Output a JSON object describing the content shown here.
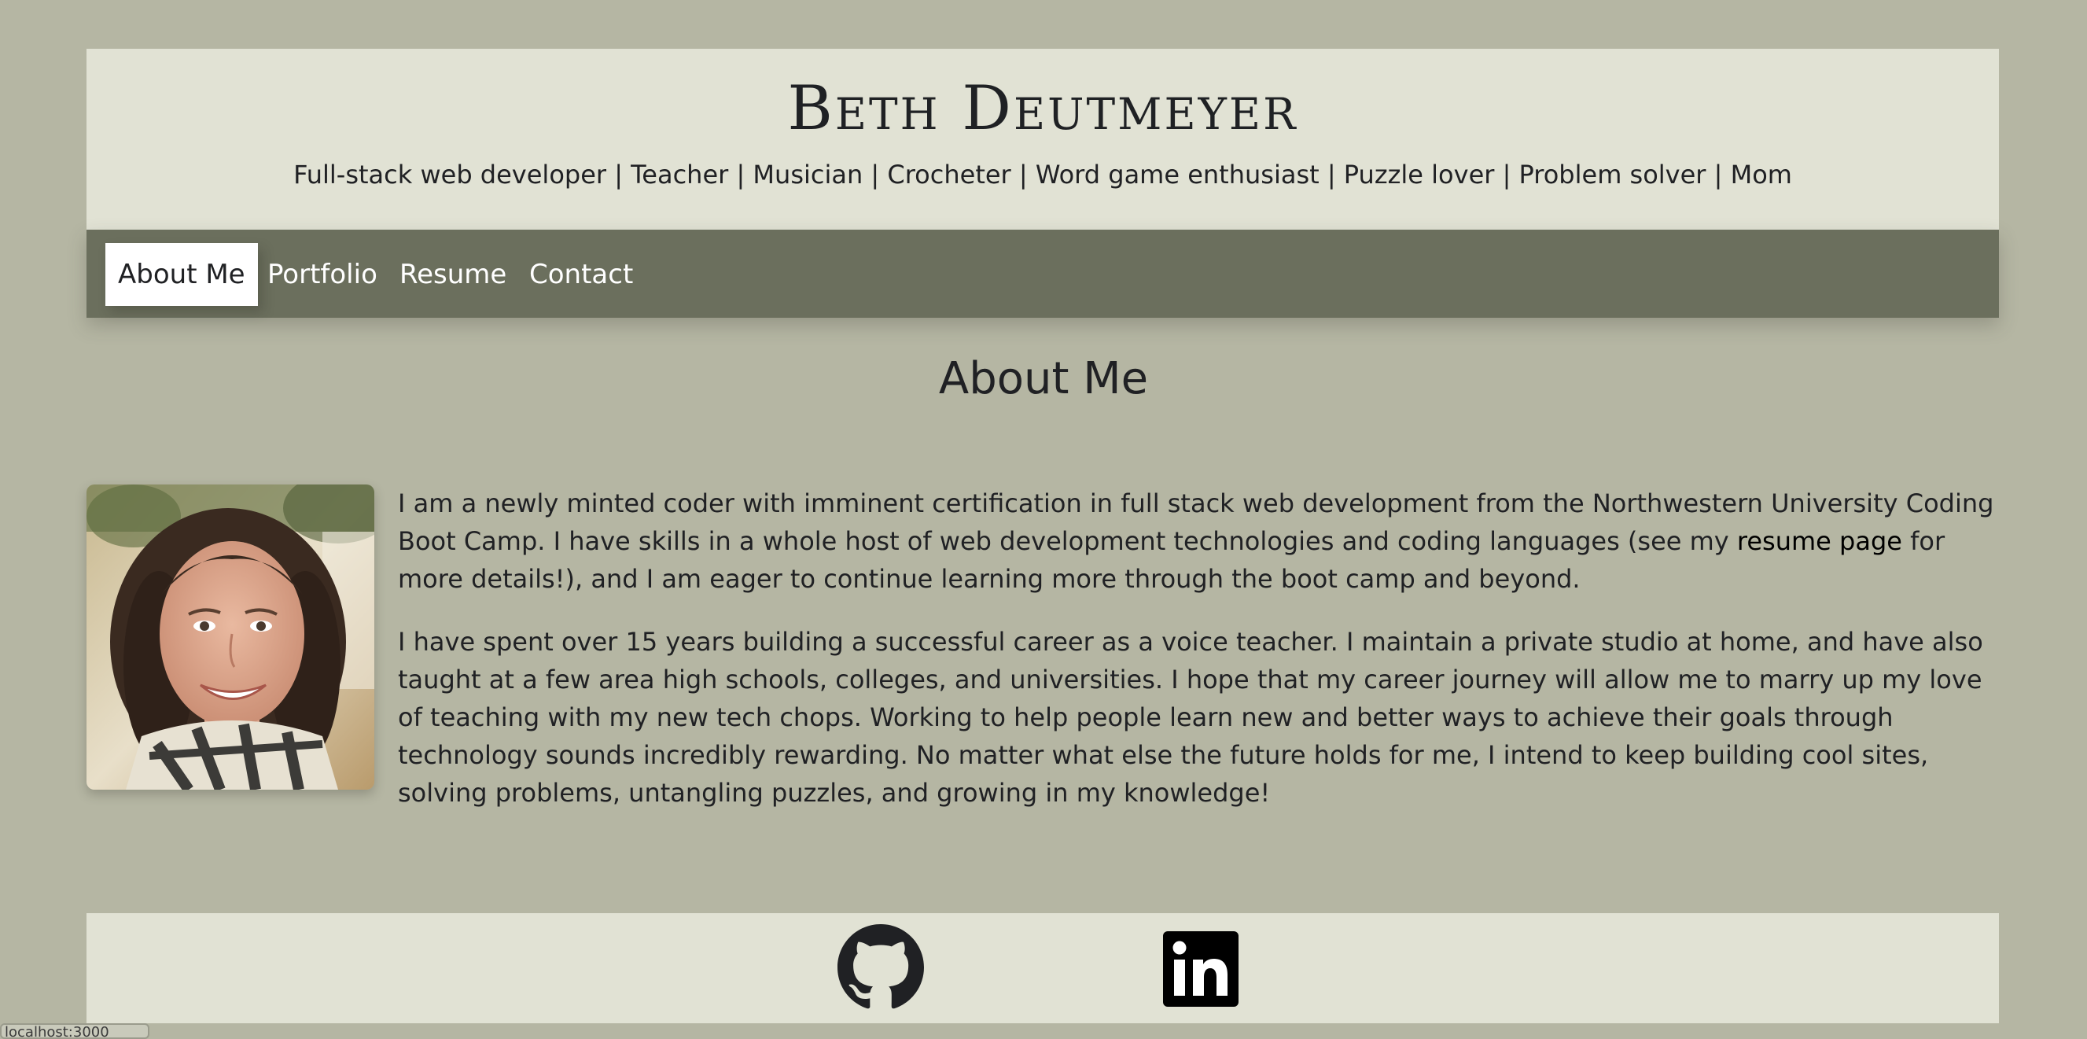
{
  "header": {
    "name": "Beth Deutmeyer",
    "tagline": "Full-stack web developer | Teacher | Musician | Crocheter | Word game enthusiast | Puzzle lover | Problem solver | Mom"
  },
  "nav": {
    "items": [
      {
        "label": "About Me",
        "active": true
      },
      {
        "label": "Portfolio",
        "active": false
      },
      {
        "label": "Resume",
        "active": false
      },
      {
        "label": "Contact",
        "active": false
      }
    ]
  },
  "main": {
    "title": "About Me",
    "photo_icon": "portrait-photo",
    "paragraph1_before": "I am a newly minted coder with imminent certification in full stack web development from the Northwestern University Coding Boot Camp. I have skills in a whole host of web development technologies and coding languages (see my ",
    "paragraph1_link": "resume page",
    "paragraph1_after": " for more details!), and I am eager to continue learning more through the boot camp and beyond.",
    "paragraph2": "I have spent over 15 years building a successful career as a voice teacher. I maintain a private studio at home, and have also taught at a few area high schools, colleges, and universities. I hope that my career journey will allow me to marry up my love of teaching with my new tech chops. Working to help people learn new and better ways to achieve their goals through technology sounds incredibly rewarding. No matter what else the future holds for me, I intend to keep building cool sites, solving problems, untangling puzzles, and growing in my knowledge!"
  },
  "footer": {
    "icons": [
      "github-icon",
      "linkedin-icon"
    ]
  },
  "status_bar": {
    "text": "localhost:3000"
  },
  "colors": {
    "page_background": "#b5b6a3",
    "header_background": "#e1e2d4",
    "nav_background": "#6b6f5d",
    "active_tab": "#ffffff",
    "text": "#202124"
  }
}
